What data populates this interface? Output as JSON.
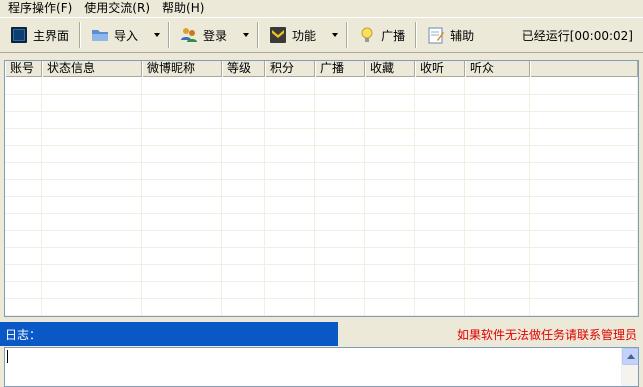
{
  "menu": {
    "items": [
      {
        "label": "程序操作",
        "accel": "(F)"
      },
      {
        "label": "使用交流",
        "accel": "(R)"
      },
      {
        "label": "帮助",
        "accel": "(H)"
      }
    ]
  },
  "toolbar": {
    "home_label": "主界面",
    "import_label": "导入",
    "login_label": "登录",
    "function_label": "功能",
    "broadcast_label": "广播",
    "assist_label": "辅助",
    "runtime_label": "已经运行",
    "runtime_value": "[00:00:02]"
  },
  "grid": {
    "columns": [
      "账号",
      "状态信息",
      "微博昵称",
      "等级",
      "积分",
      "广播",
      "收藏",
      "收听",
      "听众",
      ""
    ]
  },
  "log": {
    "label": "日志：",
    "notice": "如果软件无法做任务请联系管理员"
  },
  "colors": {
    "log_bar": "#0a57c6",
    "notice_text": "#e00000",
    "window_bg": "#ece9d8"
  }
}
